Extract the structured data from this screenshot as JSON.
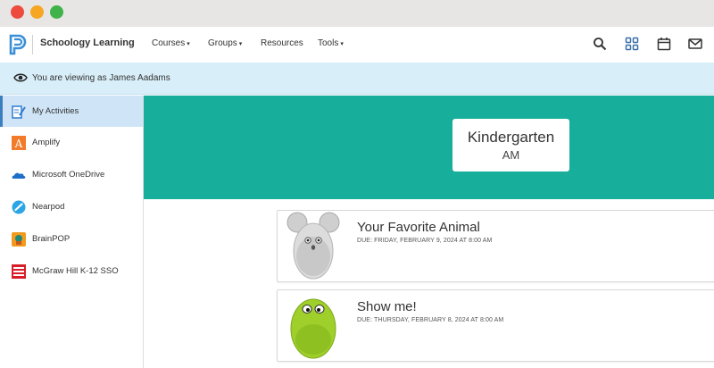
{
  "navbar": {
    "brand": "Schoology Learning",
    "items": [
      {
        "label": "Courses",
        "has_dropdown": true
      },
      {
        "label": "Groups",
        "has_dropdown": true
      },
      {
        "label": "Resources",
        "has_dropdown": false
      },
      {
        "label": "Tools",
        "has_dropdown": true
      }
    ],
    "icons": [
      "search-icon",
      "apps-icon",
      "calendar-icon",
      "mail-icon"
    ]
  },
  "banner": {
    "message": "You are viewing as James Aadams",
    "icon": "eye-icon"
  },
  "sidebar": {
    "items": [
      {
        "label": "My Activities",
        "icon": "activities-icon",
        "active": true
      },
      {
        "label": "Amplify",
        "icon": "amplify-icon",
        "active": false
      },
      {
        "label": "Microsoft OneDrive",
        "icon": "onedrive-icon",
        "active": false
      },
      {
        "label": "Nearpod",
        "icon": "nearpod-icon",
        "active": false
      },
      {
        "label": "BrainPOP",
        "icon": "brainpop-icon",
        "active": false
      },
      {
        "label": "McGraw Hill K-12 SSO",
        "icon": "mcgraw-hill-icon",
        "active": false
      }
    ]
  },
  "class": {
    "name": "Kindergarten",
    "section": "AM"
  },
  "activities": [
    {
      "title": "Your Favorite Animal",
      "due": "DUE: FRIDAY, FEBRUARY 9, 2024 AT 8:00 AM",
      "image": "mouse-egg-timer"
    },
    {
      "title": "Show me!",
      "due": "DUE: THURSDAY, FEBRUARY 8, 2024 AT 8:00 AM",
      "image": "green-egg-timer"
    }
  ],
  "colors": {
    "hero": "#17ae9c",
    "banner": "#d8eef8",
    "active_item": "#cfe5f7",
    "brand_blue": "#3b7fbf"
  }
}
